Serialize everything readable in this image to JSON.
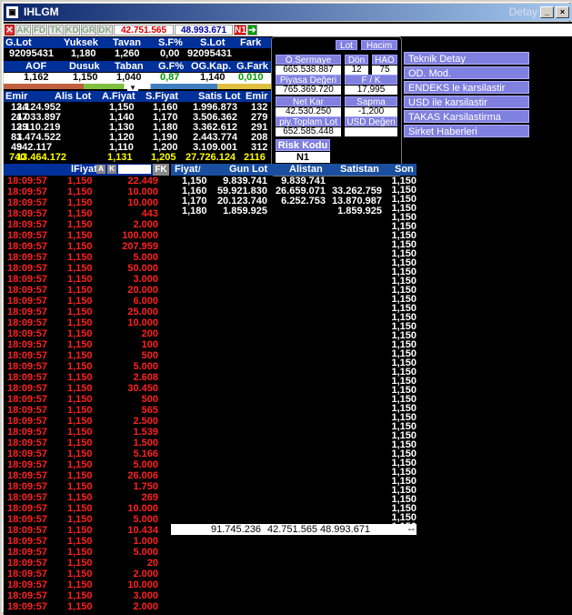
{
  "window": {
    "title": "IHLGM",
    "detay": "Detay"
  },
  "toolbar": {
    "buttons": [
      "AK",
      "FD",
      "TK",
      "KD",
      "GR",
      "DK"
    ],
    "value1": "42.751.565",
    "value2": "48.993.671",
    "n1": "N1"
  },
  "summary1": {
    "headers": [
      "G.Lot",
      "Yuksek",
      "Tavan",
      "S.F%",
      "S.Lot",
      "Fark"
    ],
    "values": [
      "92095431",
      "1,180",
      "1,260",
      "0,00",
      "92095431",
      ""
    ]
  },
  "summary2": {
    "headers": [
      "AOF",
      "Dusuk",
      "Taban",
      "G.F%",
      "OG.Kap.",
      "G.Fark"
    ],
    "values": [
      "1,162",
      "1,150",
      "1,040",
      "0,87",
      "1,140",
      "0,010"
    ]
  },
  "depth": {
    "headers": [
      "Emir",
      "Alis Lot",
      "A.Fiyat",
      "S.Fiyat",
      "Satis Lot",
      "Emir"
    ],
    "rows": [
      [
        "124",
        "3.124.952",
        "1,150",
        "1,160",
        "1.996.873",
        "132"
      ],
      [
        "217",
        "4.033.897",
        "1,140",
        "1,170",
        "3.506.362",
        "279"
      ],
      [
        "129",
        "3.110.219",
        "1,130",
        "1,180",
        "3.362.612",
        "291"
      ],
      [
        "83",
        "1.474.522",
        "1,120",
        "1,190",
        "2.443.774",
        "208"
      ],
      [
        "49",
        "342.117",
        "1,110",
        "1,200",
        "3.109.001",
        "312"
      ]
    ],
    "totals": [
      "740",
      "13.464.172",
      "1,131",
      "1,205",
      "27.726.124",
      "2116"
    ]
  },
  "panel": {
    "lot": "Lot",
    "hacim": "Hacim",
    "osermaye_label": "Ö.Sermaye",
    "osermaye_value": "665.538.887",
    "don_label": "Dön",
    "don_value": "12",
    "hao_label": "HAO",
    "hao_value": "75",
    "piyasa_label": "Piyasa Değeri",
    "piyasa_value": "765.369.720",
    "fk_label": "F / K",
    "fk_value": "17,995",
    "netkar_label": "Net Kar",
    "netkar_value": "42.530.250",
    "sapma_label": "Sapma",
    "sapma_value": "-1,200",
    "piytoplam_label": "piy.Toplam Lot",
    "piytoplam_value": "652.585.448",
    "usd_label": "USD Değeri",
    "risk_label": "Risk Kodu",
    "risk_value": "N1"
  },
  "menu": [
    "Teknik Detay",
    "OD. Mod.",
    "ENDEKS le karsilastir",
    "USD ile karsilastir",
    "TAKAS Karsilastirma",
    "Sirket Haberleri"
  ],
  "trades_header": {
    "fiyat": "lFiyat",
    "a": "A",
    "k": "K",
    "fk": "FK"
  },
  "trades": [
    [
      "18:09:57",
      "1,150",
      "22.449"
    ],
    [
      "18:09:57",
      "1,150",
      "10.000"
    ],
    [
      "18:09:57",
      "1,150",
      "10.000"
    ],
    [
      "18:09:57",
      "1,150",
      "443"
    ],
    [
      "18:09:57",
      "1,150",
      "2.000"
    ],
    [
      "18:09:57",
      "1,150",
      "100.000"
    ],
    [
      "18:09:57",
      "1,150",
      "207.959"
    ],
    [
      "18:09:57",
      "1,150",
      "5.000"
    ],
    [
      "18:09:57",
      "1,150",
      "50.000"
    ],
    [
      "18:09:57",
      "1,150",
      "3.000"
    ],
    [
      "18:09:57",
      "1,150",
      "20.000"
    ],
    [
      "18:09:57",
      "1,150",
      "6.000"
    ],
    [
      "18:09:57",
      "1,150",
      "25.000"
    ],
    [
      "18:09:57",
      "1,150",
      "10.000"
    ],
    [
      "18:09:57",
      "1,150",
      "200"
    ],
    [
      "18:09:57",
      "1,150",
      "100"
    ],
    [
      "18:09:57",
      "1,150",
      "500"
    ],
    [
      "18:09:57",
      "1,150",
      "5.000"
    ],
    [
      "18:09:57",
      "1,150",
      "2.608"
    ],
    [
      "18:09:57",
      "1,150",
      "30.450"
    ],
    [
      "18:09:57",
      "1,150",
      "500"
    ],
    [
      "18:09:57",
      "1,150",
      "565"
    ],
    [
      "18:09:57",
      "1,150",
      "2.500"
    ],
    [
      "18:09:57",
      "1,150",
      "1.539"
    ],
    [
      "18:09:57",
      "1,150",
      "1.500"
    ],
    [
      "18:09:57",
      "1,150",
      "5.166"
    ],
    [
      "18:09:57",
      "1,150",
      "5.000"
    ],
    [
      "18:09:57",
      "1,150",
      "26.006"
    ],
    [
      "18:09:57",
      "1,150",
      "1.750"
    ],
    [
      "18:09:57",
      "1,150",
      "269"
    ],
    [
      "18:09:57",
      "1,150",
      "10.000"
    ],
    [
      "18:09:57",
      "1,150",
      "5.000"
    ],
    [
      "18:09:57",
      "1,150",
      "10.434"
    ],
    [
      "18:09:57",
      "1,150",
      "1.000"
    ],
    [
      "18:09:57",
      "1,150",
      "5.000"
    ],
    [
      "18:09:57",
      "1,150",
      "20"
    ],
    [
      "18:09:57",
      "1,150",
      "2.000"
    ],
    [
      "18:09:57",
      "1,150",
      "10.000"
    ],
    [
      "18:09:57",
      "1,150",
      "3.000"
    ],
    [
      "18:09:57",
      "1,150",
      "2.000"
    ]
  ],
  "dist_header": [
    "Fiyat",
    "Gun Lot",
    "Alistan",
    "Satistan",
    "Son"
  ],
  "dist_rows": [
    [
      "1,150",
      "9.839.741",
      "9.839.741",
      ""
    ],
    [
      "1,160",
      "59.921.830",
      "26.659.071",
      "33.262.759"
    ],
    [
      "1,170",
      "20.123.740",
      "6.252.753",
      "13.870.987"
    ],
    [
      "1,180",
      "1.859.925",
      "",
      "1.859.925"
    ]
  ],
  "dist_total": {
    "gunlot": "91.745.236",
    "alistan": "42.751.565",
    "satistan": "48.993.671",
    "son": "--"
  },
  "son_values": [
    "1,150",
    "1,150",
    "1,150",
    "1,150",
    "1,150",
    "1,150",
    "1,150",
    "1,150",
    "1,150",
    "1,150",
    "1,150",
    "1,150",
    "1,150",
    "1,150",
    "1,150",
    "1,150",
    "1,150",
    "1,150",
    "1,150",
    "1,150",
    "1,150",
    "1,150",
    "1,150",
    "1,150",
    "1,150",
    "1,150",
    "1,150",
    "1,150",
    "1,150",
    "1,150",
    "1,150",
    "1,150",
    "1,150",
    "1,150",
    "1,150",
    "1,150",
    "1,150",
    "1,150",
    "1,150"
  ]
}
